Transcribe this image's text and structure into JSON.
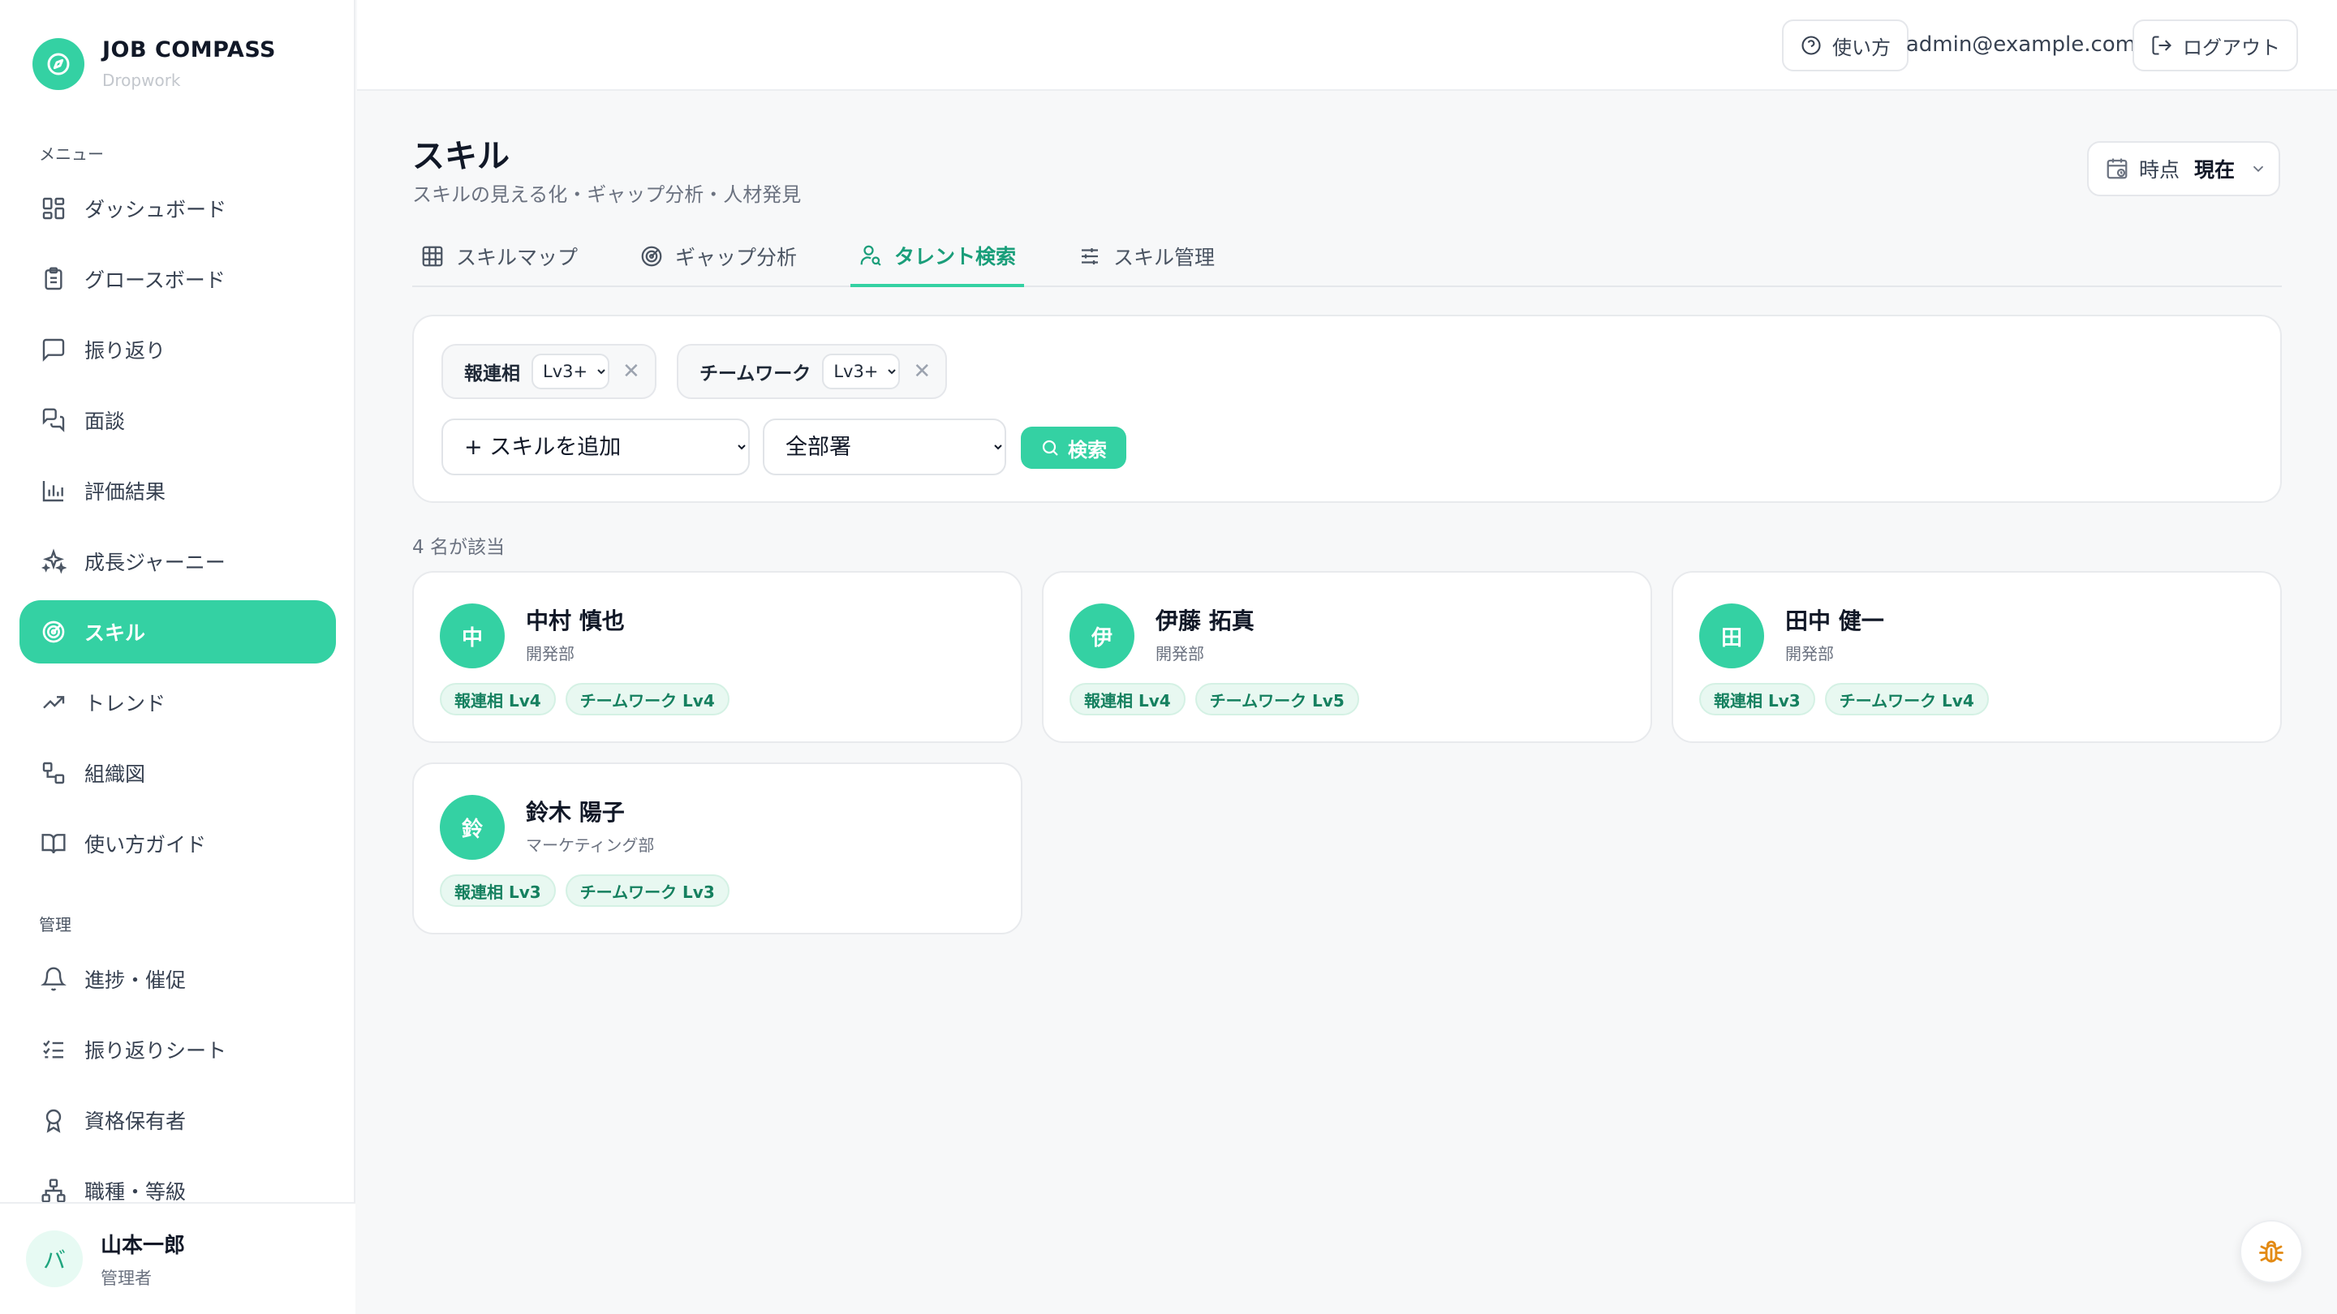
{
  "brand": {
    "title": "JOB COMPASS",
    "subtitle": "Dropwork"
  },
  "sidebar": {
    "menu_label": "メニュー",
    "menu_items": [
      {
        "label": "ダッシュボード",
        "icon": "dashboard-icon"
      },
      {
        "label": "グロースボード",
        "icon": "clipboard-icon"
      },
      {
        "label": "振り返り",
        "icon": "message-square-icon"
      },
      {
        "label": "面談",
        "icon": "messages-icon"
      },
      {
        "label": "評価結果",
        "icon": "bar-chart-icon"
      },
      {
        "label": "成長ジャーニー",
        "icon": "sparkles-icon"
      },
      {
        "label": "スキル",
        "icon": "target-icon",
        "active": true
      },
      {
        "label": "トレンド",
        "icon": "trending-up-icon"
      },
      {
        "label": "組織図",
        "icon": "org-chart-icon"
      },
      {
        "label": "使い方ガイド",
        "icon": "book-icon"
      }
    ],
    "admin_label": "管理",
    "admin_items": [
      {
        "label": "進捗・催促",
        "icon": "bell-icon"
      },
      {
        "label": "振り返りシート",
        "icon": "list-checks-icon"
      },
      {
        "label": "資格保有者",
        "icon": "award-icon"
      },
      {
        "label": "職種・等級",
        "icon": "hierarchy-icon"
      }
    ],
    "user": {
      "initial": "バ",
      "name": "山本一郎",
      "role": "管理者"
    }
  },
  "topbar": {
    "help": "使い方",
    "email": "admin@example.com",
    "logout": "ログアウト"
  },
  "page": {
    "title": "スキル",
    "subtitle": "スキルの見える化・ギャップ分析・人材発見",
    "time_label": "時点",
    "time_value": "現在"
  },
  "tabs": [
    {
      "label": "スキルマップ",
      "icon": "grid-icon"
    },
    {
      "label": "ギャップ分析",
      "icon": "target-icon"
    },
    {
      "label": "タレント検索",
      "icon": "user-search-icon",
      "active": true
    },
    {
      "label": "スキル管理",
      "icon": "sliders-icon"
    }
  ],
  "filters": {
    "chips": [
      {
        "skill": "報連相",
        "level": "Lv3+"
      },
      {
        "skill": "チームワーク",
        "level": "Lv3+"
      }
    ],
    "add_skill": "+ スキルを追加",
    "department": "全部署",
    "search_button": "検索"
  },
  "results": {
    "count_text": "4 名が該当",
    "people": [
      {
        "initial": "中",
        "name": "中村 慎也",
        "dept": "開発部",
        "tags": [
          "報連相 Lv4",
          "チームワーク Lv4"
        ]
      },
      {
        "initial": "伊",
        "name": "伊藤 拓真",
        "dept": "開発部",
        "tags": [
          "報連相 Lv4",
          "チームワーク Lv5"
        ]
      },
      {
        "initial": "田",
        "name": "田中 健一",
        "dept": "開発部",
        "tags": [
          "報連相 Lv3",
          "チームワーク Lv4"
        ]
      },
      {
        "initial": "鈴",
        "name": "鈴木 陽子",
        "dept": "マーケティング部",
        "tags": [
          "報連相 Lv3",
          "チームワーク Lv3"
        ]
      }
    ]
  },
  "colors": {
    "accent": "#34d1a3",
    "accent_dark": "#1a9e7a",
    "tag_bg": "#e8f8f1"
  }
}
